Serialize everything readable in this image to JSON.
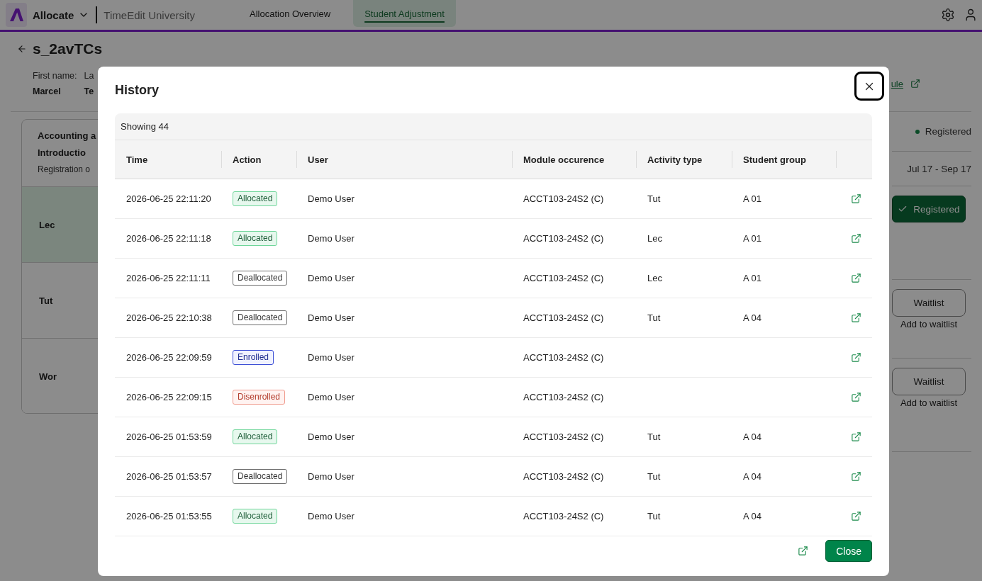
{
  "app_header": {
    "app_name": "Allocate",
    "organization": "TimeEdit University",
    "nav_tabs": [
      {
        "label": "Allocation Overview",
        "selected": false
      },
      {
        "label": "Student Adjustment",
        "selected": true
      }
    ]
  },
  "student": {
    "title": "s_2avTCs",
    "fields": [
      {
        "label": "First name:",
        "value": "Marcel"
      },
      {
        "label": "La",
        "value": "Te"
      }
    ],
    "schedule_link": "ule"
  },
  "module_card": {
    "title_lines": [
      "Accounting a",
      "Introductio"
    ],
    "subtitle": "Registration o",
    "activities": [
      {
        "label": "Lec",
        "selected": true
      },
      {
        "label": "Tut",
        "selected": false
      },
      {
        "label": "Wor",
        "selected": false
      }
    ]
  },
  "registration_panel": {
    "status": "Registered",
    "dates": "Jul 17 - Sep 17",
    "actions": [
      {
        "kind": "registered",
        "label": "Registered"
      },
      {
        "kind": "waitlist",
        "label": "Waitlist",
        "note": "Add to waitlist"
      },
      {
        "kind": "waitlist",
        "label": "Waitlist",
        "note": "Add to waitlist"
      }
    ]
  },
  "history_dialog": {
    "title": "History",
    "count_label": "Showing 44",
    "columns": [
      "Time",
      "Action",
      "User",
      "Module occurence",
      "Activity type",
      "Student group"
    ],
    "rows": [
      {
        "time": "2026-06-25 22:11:20",
        "action": {
          "label": "Allocated",
          "kind": "positive"
        },
        "user": "Demo User",
        "module": "ACCT103-24S2 (C)",
        "activity_type": "Tut",
        "student_group": "A 01"
      },
      {
        "time": "2026-06-25 22:11:18",
        "action": {
          "label": "Allocated",
          "kind": "positive"
        },
        "user": "Demo User",
        "module": "ACCT103-24S2 (C)",
        "activity_type": "Lec",
        "student_group": "A 01"
      },
      {
        "time": "2026-06-25 22:11:11",
        "action": {
          "label": "Deallocated",
          "kind": "neutral"
        },
        "user": "Demo User",
        "module": "ACCT103-24S2 (C)",
        "activity_type": "Lec",
        "student_group": "A 01"
      },
      {
        "time": "2026-06-25 22:10:38",
        "action": {
          "label": "Deallocated",
          "kind": "neutral"
        },
        "user": "Demo User",
        "module": "ACCT103-24S2 (C)",
        "activity_type": "Tut",
        "student_group": "A 04"
      },
      {
        "time": "2026-06-25 22:09:59",
        "action": {
          "label": "Enrolled",
          "kind": "info"
        },
        "user": "Demo User",
        "module": "ACCT103-24S2 (C)"
      },
      {
        "time": "2026-06-25 22:09:15",
        "action": {
          "label": "Disenrolled",
          "kind": "negative"
        },
        "user": "Demo User",
        "module": "ACCT103-24S2 (C)"
      },
      {
        "time": "2026-06-25 01:53:59",
        "action": {
          "label": "Allocated",
          "kind": "positive"
        },
        "user": "Demo User",
        "module": "ACCT103-24S2 (C)",
        "activity_type": "Tut",
        "student_group": "A 04"
      },
      {
        "time": "2026-06-25 01:53:57",
        "action": {
          "label": "Deallocated",
          "kind": "neutral"
        },
        "user": "Demo User",
        "module": "ACCT103-24S2 (C)",
        "activity_type": "Tut",
        "student_group": "A 04"
      },
      {
        "time": "2026-06-25 01:53:55",
        "action": {
          "label": "Allocated",
          "kind": "positive"
        },
        "user": "Demo User",
        "module": "ACCT103-24S2 (C)",
        "activity_type": "Tut",
        "student_group": "A 04"
      }
    ],
    "close_button": "Close"
  }
}
